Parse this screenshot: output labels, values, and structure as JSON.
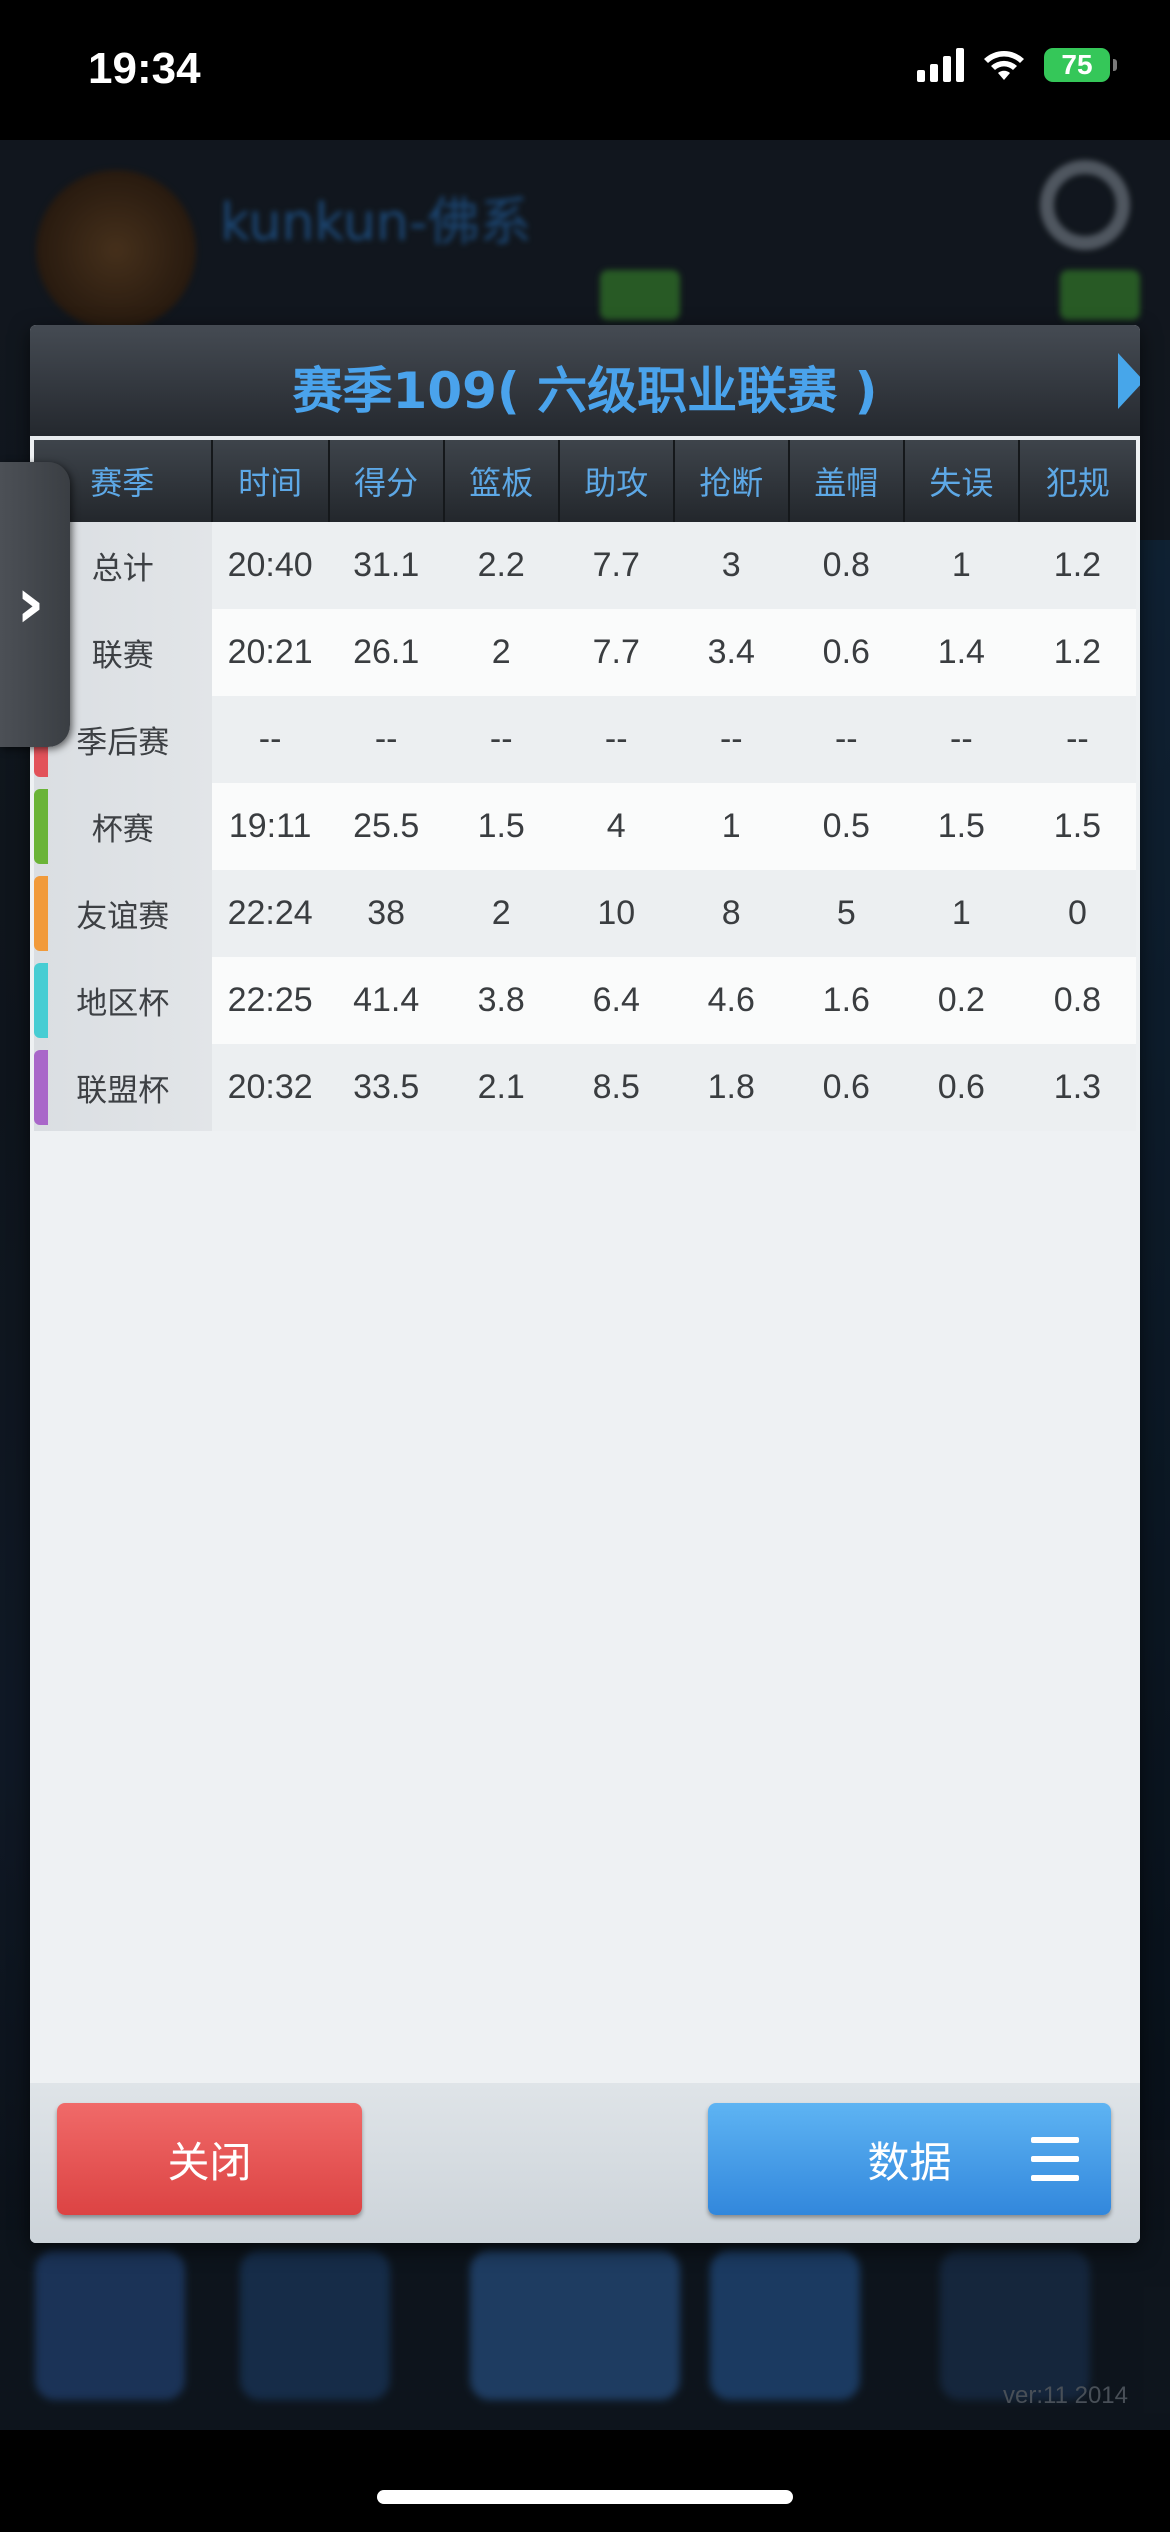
{
  "status_bar": {
    "time": "19:34",
    "battery": "75"
  },
  "background": {
    "name_text": "kunkun-佛系",
    "version_text": "ver:11  2014"
  },
  "dialog": {
    "title": "赛季109( 六级职业联赛 )",
    "columns": [
      "赛季",
      "时间",
      "得分",
      "篮板",
      "助攻",
      "抢断",
      "盖帽",
      "失误",
      "犯规"
    ],
    "rows": [
      {
        "label": "总计",
        "stripe_color": "",
        "values": [
          "20:40",
          "31.1",
          "2.2",
          "7.7",
          "3",
          "0.8",
          "1",
          "1.2"
        ]
      },
      {
        "label": "联赛",
        "stripe_color": "",
        "values": [
          "20:21",
          "26.1",
          "2",
          "7.7",
          "3.4",
          "0.6",
          "1.4",
          "1.2"
        ]
      },
      {
        "label": "季后赛",
        "stripe_color": "#e2525a",
        "values": [
          "--",
          "--",
          "--",
          "--",
          "--",
          "--",
          "--",
          "--"
        ]
      },
      {
        "label": "杯赛",
        "stripe_color": "#6ab437",
        "values": [
          "19:11",
          "25.5",
          "1.5",
          "4",
          "1",
          "0.5",
          "1.5",
          "1.5"
        ]
      },
      {
        "label": "友谊赛",
        "stripe_color": "#f19a3a",
        "values": [
          "22:24",
          "38",
          "2",
          "10",
          "8",
          "5",
          "1",
          "0"
        ]
      },
      {
        "label": "地区杯",
        "stripe_color": "#47cdd3",
        "values": [
          "22:25",
          "41.4",
          "3.8",
          "6.4",
          "4.6",
          "1.6",
          "0.2",
          "0.8"
        ]
      },
      {
        "label": "联盟杯",
        "stripe_color": "#a967c9",
        "values": [
          "20:32",
          "33.5",
          "2.1",
          "8.5",
          "1.8",
          "0.6",
          "0.6",
          "1.3"
        ]
      }
    ],
    "close_label": "关闭",
    "data_label": "数据"
  }
}
